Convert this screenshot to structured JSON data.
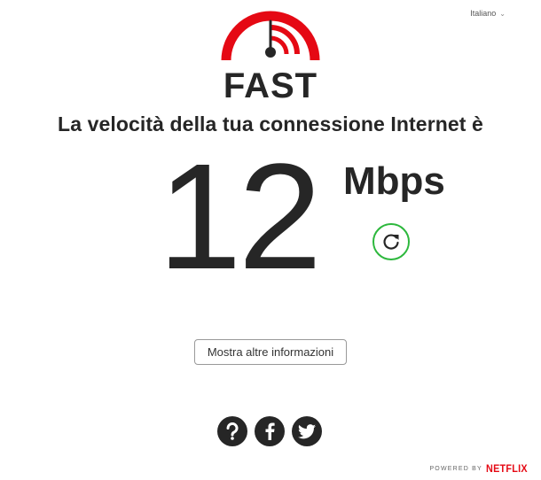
{
  "language": {
    "selected": "Italiano"
  },
  "logo": {
    "text": "FAST",
    "accent_color": "#e50914"
  },
  "headline": "La velocità della tua connessione Internet è",
  "speed": {
    "value": "12",
    "unit": "Mbps"
  },
  "refresh": {
    "icon": "refresh-icon",
    "ring_color": "#2db83d"
  },
  "more_info_button": "Mostra altre informazioni",
  "social": [
    {
      "name": "help",
      "icon": "question-icon"
    },
    {
      "name": "facebook",
      "icon": "facebook-icon"
    },
    {
      "name": "twitter",
      "icon": "twitter-icon"
    }
  ],
  "footer": {
    "powered_by": "POWERED BY",
    "brand": "NETFLIX",
    "brand_color": "#e50914"
  }
}
